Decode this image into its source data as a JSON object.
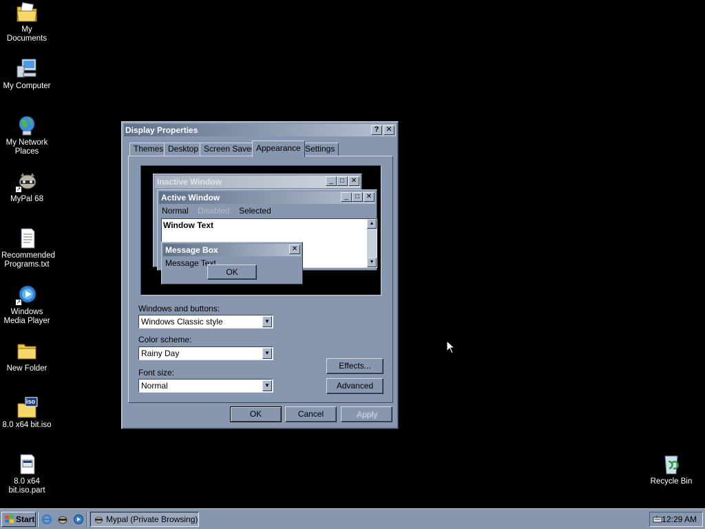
{
  "desktop": {
    "icons": [
      {
        "label": "My Documents"
      },
      {
        "label": "My Computer"
      },
      {
        "label": "My Network Places"
      },
      {
        "label": "MyPal 68"
      },
      {
        "label": "Recommended Programs.txt"
      },
      {
        "label": "Windows Media Player"
      },
      {
        "label": "New Folder"
      },
      {
        "label": "8.0 x64 bit.iso"
      },
      {
        "label": "8.0 x64 bit.iso.part"
      },
      {
        "label": "Recycle Bin"
      }
    ],
    "iso_badge": "iso"
  },
  "dialog": {
    "title": "Display Properties",
    "help_glyph": "?",
    "close_glyph": "✕",
    "tabs": [
      {
        "label": "Themes"
      },
      {
        "label": "Desktop"
      },
      {
        "label": "Screen Saver"
      },
      {
        "label": "Appearance",
        "active": true
      },
      {
        "label": "Settings"
      }
    ],
    "preview": {
      "inactive_title": "Inactive Window",
      "active_title": "Active Window",
      "menu_normal": "Normal",
      "menu_disabled": "Disabled",
      "menu_selected": "Selected",
      "window_text": "Window Text",
      "message_title": "Message Box",
      "message_text": "Message Text",
      "ok": "OK"
    },
    "windows_buttons": {
      "label": "Windows and buttons:",
      "value": "Windows Classic style"
    },
    "color_scheme": {
      "label": "Color scheme:",
      "value": "Rainy Day"
    },
    "font_size": {
      "label": "Font size:",
      "value": "Normal"
    },
    "effects_button": "Effects...",
    "advanced_button": "Advanced",
    "ok_button": "OK",
    "cancel_button": "Cancel",
    "apply_button": "Apply"
  },
  "taskbar": {
    "start_label": "Start",
    "task_label": "Mypal (Private Browsing)",
    "clock": "12:29 AM"
  },
  "colors": {
    "desktop": "#000000",
    "face": "#8797b0",
    "active_title_start": "#5f7089",
    "active_title_end": "#b8c3d2"
  }
}
